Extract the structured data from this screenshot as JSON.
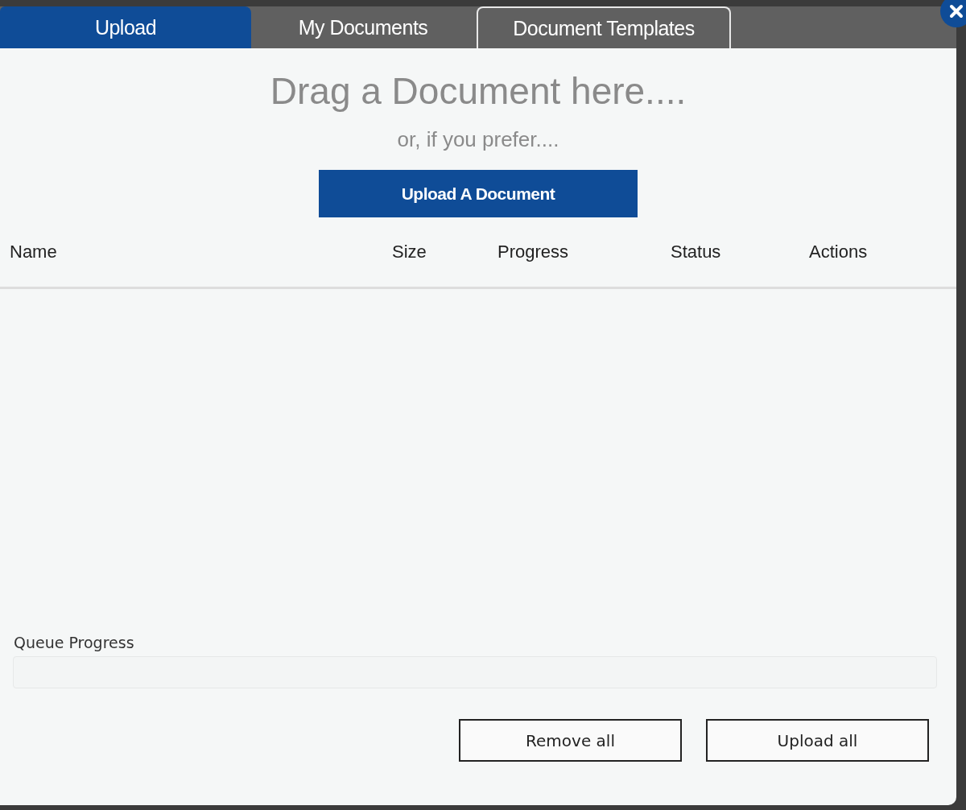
{
  "tabs": [
    {
      "label": "Upload",
      "selected": true
    },
    {
      "label": "My Documents",
      "selected": false
    },
    {
      "label": "Document Templates",
      "selected": false
    }
  ],
  "drop_zone": {
    "title": "Drag a Document here....",
    "subtitle": "or, if you prefer....",
    "button": "Upload A Document"
  },
  "table": {
    "columns": [
      "Name",
      "Size",
      "Progress",
      "Status",
      "Actions"
    ]
  },
  "queue": {
    "label": "Queue Progress",
    "level": 0
  },
  "buttons": [
    "Remove all",
    "Upload all"
  ]
}
